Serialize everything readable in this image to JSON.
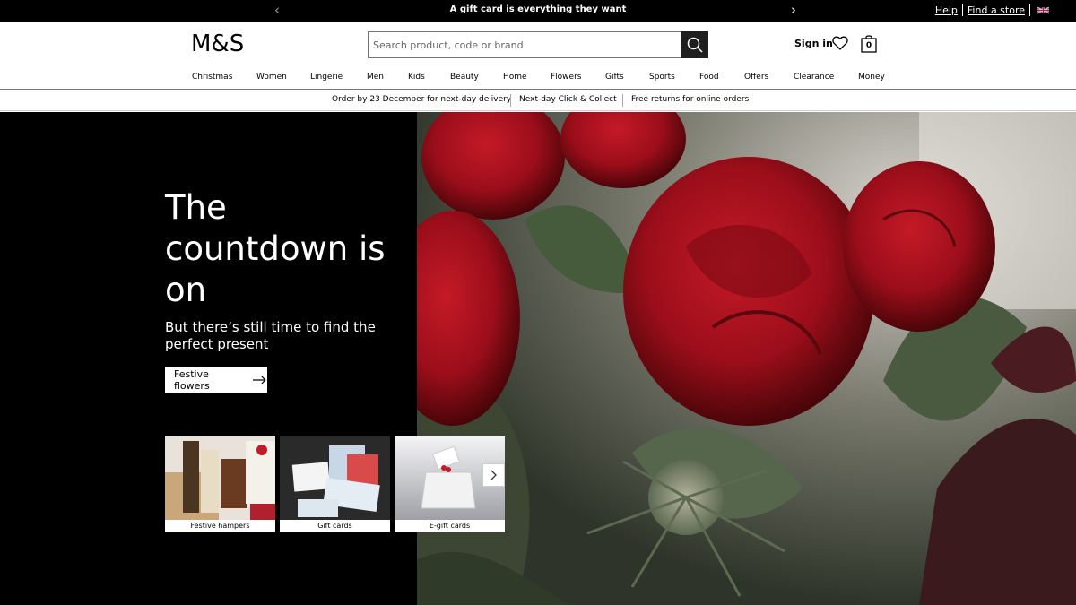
{
  "promo": {
    "text": "A gift card is everything they want",
    "prev_arrow": "‹",
    "next_arrow": "›"
  },
  "utility": {
    "help": "Help",
    "find_store": "Find a store",
    "flag_icon": "uk-flag-icon"
  },
  "header": {
    "logo": "M&S",
    "search_placeholder": "Search product, code or brand",
    "search_icon": "search-icon",
    "sign_in": "Sign in",
    "wishlist_icon": "heart-icon",
    "bag_icon": "shopping-bag-icon",
    "bag_count": "0"
  },
  "nav": {
    "items": [
      "Christmas",
      "Women",
      "Lingerie",
      "Men",
      "Kids",
      "Beauty",
      "Home",
      "Flowers",
      "Gifts",
      "Sports",
      "Food",
      "Offers",
      "Clearance",
      "Money"
    ]
  },
  "service": {
    "items": [
      "Order by 23 December for next-day delivery",
      "Next-day Click & Collect",
      "Free returns for online orders"
    ]
  },
  "hero": {
    "title": "The countdown is on",
    "subtitle": "But there’s still time to find the perfect present",
    "cta_label": "Festive flowers",
    "tiles": [
      {
        "label": "Festive hampers"
      },
      {
        "label": "Gift cards"
      },
      {
        "label": "E-gift cards"
      }
    ]
  },
  "colors": {
    "black": "#000000",
    "white": "#ffffff",
    "rose_red": "#a3101c",
    "foliage": "#3e4a36"
  }
}
